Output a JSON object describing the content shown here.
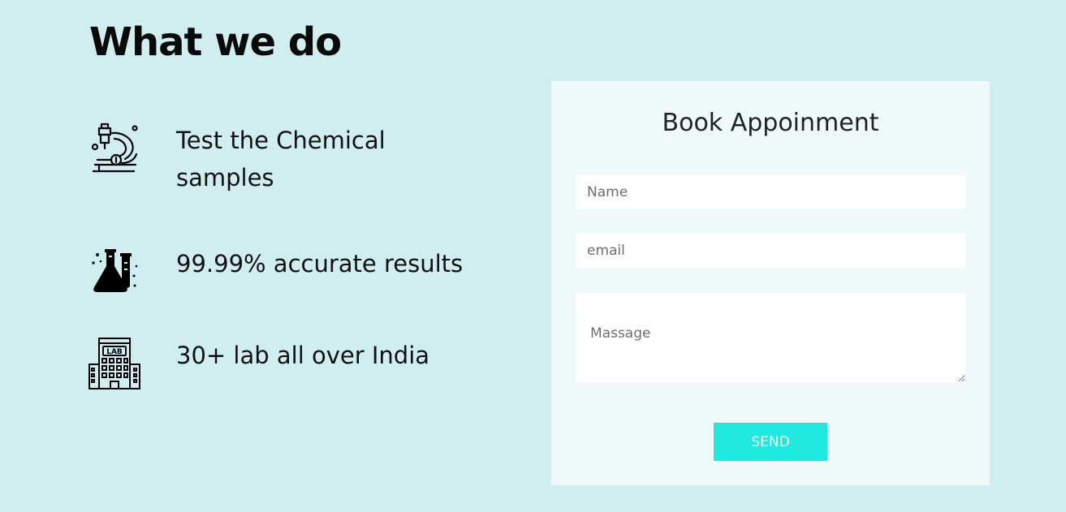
{
  "section": {
    "title": "What we do"
  },
  "features": [
    {
      "icon": "microscope-icon",
      "text": "Test the Chemical samples"
    },
    {
      "icon": "lab-flask-icon",
      "text": "99.99% accurate results"
    },
    {
      "icon": "lab-building-icon",
      "text": "30+ lab all over India",
      "icon_label": "LAB"
    }
  ],
  "form": {
    "title": "Book Appoinment",
    "name_placeholder": "Name",
    "email_placeholder": "email",
    "message_placeholder": "Massage",
    "send_label": "SEND"
  },
  "colors": {
    "background": "#d0edef",
    "card": "#eff9fa",
    "accent": "#1fe8de"
  }
}
